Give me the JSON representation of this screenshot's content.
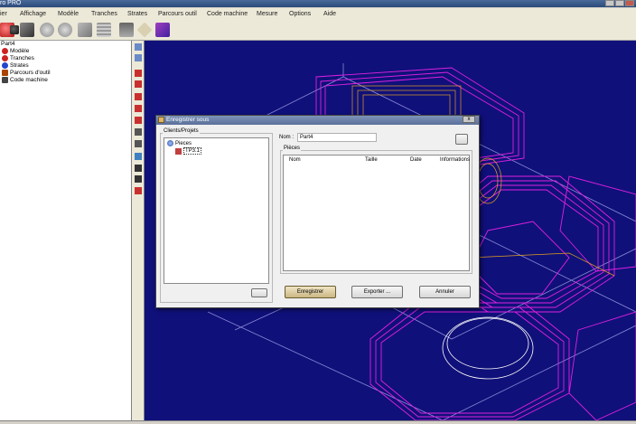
{
  "app": {
    "title": "ro PRO"
  },
  "menu": {
    "items": [
      {
        "label": "ier"
      },
      {
        "label": "Affichage"
      },
      {
        "label": "Modèle"
      },
      {
        "label": "Tranches"
      },
      {
        "label": "Strates"
      },
      {
        "label": "Parcours outil"
      },
      {
        "label": "Code machine"
      },
      {
        "label": "Mesure"
      },
      {
        "label": "Options"
      },
      {
        "label": "Aide"
      }
    ]
  },
  "toolbar": {
    "icons": [
      "sphere-red-icon",
      "sphere-black-icon",
      "machine-icon",
      "layers-icon",
      "slices-icon",
      "slices2-icon",
      "wedge-icon",
      "list-icon",
      "printer-icon",
      "diamond-icon",
      "export-icon"
    ]
  },
  "tree": {
    "root": "Part4",
    "children": [
      {
        "label": "Modèle",
        "icon": "model-icon",
        "color": "#cc2222"
      },
      {
        "label": "Tranches",
        "icon": "slices-icon",
        "color": "#cc2222"
      },
      {
        "label": "Strates",
        "icon": "strata-icon",
        "color": "#2244cc"
      },
      {
        "label": "Parcours d'outil",
        "icon": "toolpath-icon",
        "color": "#aa4400"
      },
      {
        "label": "Code machine",
        "icon": "code-icon",
        "color": "#444444"
      }
    ]
  },
  "dialog": {
    "title": "Enregistrer sous",
    "close": "x",
    "clients_label": "Clients/Projets",
    "tree_root": "Pieces",
    "tree_child": "TP3.1",
    "name_label": "Nom :",
    "name_value": "Part4",
    "pieces_label": "Pièces",
    "columns": [
      "Nom",
      "Taille",
      "Date",
      "Informations"
    ],
    "save": "Enregistrer",
    "export": "Exporter ...",
    "cancel": "Annuler"
  },
  "colors": {
    "viewport_bg": "#10107a",
    "toolpath_magenta": "#e020e0",
    "toolpath_orange": "#e0a020",
    "wireframe": "#8a8ad8"
  }
}
